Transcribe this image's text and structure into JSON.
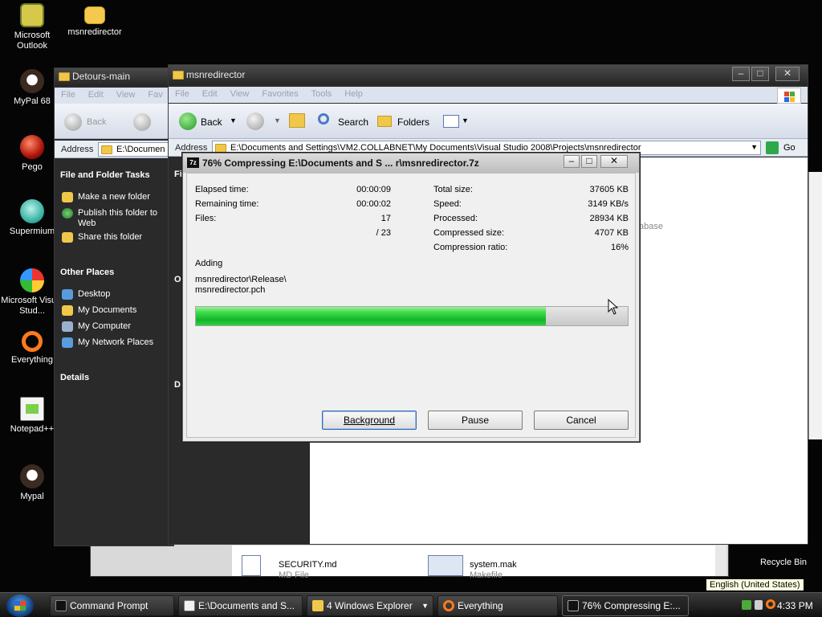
{
  "desktop": {
    "icons": [
      {
        "label": "Microsoft Outlook",
        "icon": "outlook-icon"
      },
      {
        "label": "msnredirector",
        "icon": "folder-icon"
      },
      {
        "label": "MyPal 68",
        "icon": "mypal-icon"
      },
      {
        "label": "Pego",
        "icon": "pego-icon"
      },
      {
        "label": "Supermium",
        "icon": "supermium-icon"
      },
      {
        "label": "Microsoft Visual Stud...",
        "icon": "visual-studio-icon"
      },
      {
        "label": "Everything",
        "icon": "everything-icon"
      },
      {
        "label": "Notepad++",
        "icon": "notepadpp-icon"
      },
      {
        "label": "Mypal",
        "icon": "mypal-icon"
      },
      {
        "label": "Recycle Bin",
        "icon": "recycle-bin-icon"
      }
    ]
  },
  "bg_window": {
    "title": "Detours-main",
    "menu": [
      "File",
      "Edit",
      "View",
      "Fav"
    ],
    "back": "Back",
    "address_label": "Address",
    "address_value": "E:\\Documen",
    "tasks_header": "File and Folder Tasks",
    "tasks": [
      "Make a new folder",
      "Publish this folder to Web",
      "Share this folder"
    ],
    "other_header": "Other Places",
    "places": [
      "Desktop",
      "My Documents",
      "My Computer",
      "My Network Places"
    ],
    "details_header": "Details"
  },
  "main_window": {
    "title": "msnredirector",
    "menu": [
      "File",
      "Edit",
      "View",
      "Favorites",
      "Tools",
      "Help"
    ],
    "back": "Back",
    "search": "Search",
    "folders": "Folders",
    "address_label": "Address",
    "address_value": "E:\\Documents and Settings\\VM2.COLLABNET\\My Documents\\Visual Studio 2008\\Projects\\msnredirector",
    "go": "Go",
    "partial_text": "abase",
    "left_partial": [
      "Fi",
      "O",
      "D"
    ]
  },
  "files_window": {
    "items": [
      {
        "name": "SECURITY.md",
        "type": "MD File"
      },
      {
        "name": "system.mak",
        "type": "Makefile"
      }
    ]
  },
  "dialog": {
    "title": "76% Compressing E:\\Documents and S ... r\\msnredirector.7z",
    "elapsed_label": "Elapsed time:",
    "elapsed": "00:00:09",
    "remaining_label": "Remaining time:",
    "remaining": "00:00:02",
    "files_label": "Files:",
    "files": "17",
    "files_total": "/ 23",
    "total_label": "Total size:",
    "total": "37605 KB",
    "speed_label": "Speed:",
    "speed": "3149 KB/s",
    "processed_label": "Processed:",
    "processed": "28934 KB",
    "compressed_label": "Compressed size:",
    "compressed": "4707 KB",
    "ratio_label": "Compression ratio:",
    "ratio": "16%",
    "action": "Adding",
    "path_line1": "msnredirector\\Release\\",
    "path_line2": "msnredirector.pch",
    "progress": 0.81,
    "btn_background": "Background",
    "btn_pause": "Pause",
    "btn_cancel": "Cancel"
  },
  "taskbar": {
    "buttons": [
      {
        "label": "Command Prompt",
        "icon": "cmd-icon"
      },
      {
        "label": "E:\\Documents and S...",
        "icon": "notepad-icon"
      },
      {
        "label": "4 Windows Explorer",
        "icon": "folder-icon"
      },
      {
        "label": "Everything",
        "icon": "everything-icon"
      },
      {
        "label": "76% Compressing E:...",
        "icon": "7zip-icon"
      }
    ],
    "language_tooltip": "English (United States)",
    "clock": "4:33 PM"
  },
  "colors": {
    "progress_fill": "#22c63a",
    "progress_track": "#d4d4d4",
    "desktop_bg": "#050505"
  }
}
